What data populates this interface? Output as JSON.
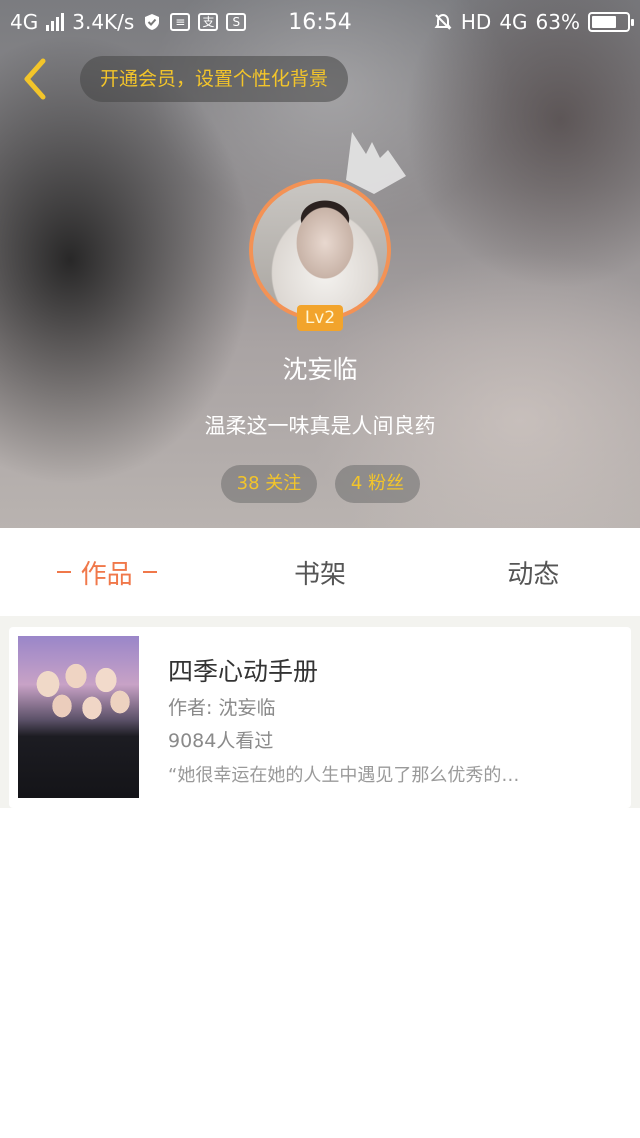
{
  "status_bar": {
    "network_left": "4G",
    "speed": "3.4K/s",
    "time": "16:54",
    "hd": "HD",
    "network_right": "4G",
    "battery": "63%"
  },
  "header": {
    "vip_prompt": "开通会员，设置个性化背景",
    "level": "Lv2",
    "nickname": "沈妄临",
    "signature": "温柔这一味真是人间良药",
    "follow_label": "38 关注",
    "fans_label": "4 粉丝",
    "colors": {
      "accent": "#f3c52a",
      "avatar_ring": "#f39255",
      "badge": "#f2a42c"
    }
  },
  "tabs": [
    {
      "label": "作品",
      "active": true
    },
    {
      "label": "书架",
      "active": false
    },
    {
      "label": "动态",
      "active": false
    }
  ],
  "works": [
    {
      "title": "四季心动手册",
      "author": "作者: 沈妄临",
      "views": "9084人看过",
      "excerpt": "“她很幸运在她的人生中遇见了那么优秀的…"
    }
  ],
  "icons": {
    "back": "chevron-left-icon",
    "crown": "crown-icon"
  },
  "theme": {
    "tab_active": "#f0784a"
  }
}
